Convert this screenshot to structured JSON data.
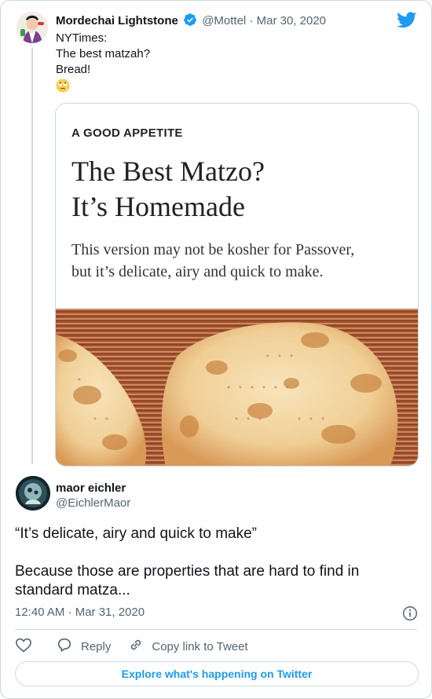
{
  "parent_tweet": {
    "author_name": "Mordechai Lightstone",
    "handle": "@Mottel",
    "separator": "·",
    "date": "Mar 30, 2020",
    "text_lines": [
      "NYTimes:",
      "The best matzah?",
      "Bread!"
    ],
    "emoji": "face-with-rolling-eyes",
    "media": {
      "kicker": "A GOOD APPETITE",
      "headline_lines": [
        "The Best Matzo?",
        "It’s Homemade"
      ],
      "dek_lines": [
        "This version may not be kosher for Passover,",
        "but it’s delicate, airy and quick to make."
      ],
      "photo": "homemade-matzo-on-baking-sheet"
    }
  },
  "reply_tweet": {
    "author_name": "maor eichler",
    "handle": "@EichlerMaor",
    "text_lines": [
      "“It’s delicate, airy and quick to make”",
      "",
      "Because those are properties that are hard to find in",
      "standard matza..."
    ],
    "timestamp": "12:40 AM · Mar 31, 2020"
  },
  "actions": {
    "like_icon": "heart-icon",
    "reply_label": "Reply",
    "copy_label": "Copy link to Tweet"
  },
  "explore_label": "Explore what's happening on Twitter",
  "colors": {
    "twitter_blue": "#1d9bf0",
    "secondary_text": "#536471",
    "border": "#cfd9de"
  }
}
